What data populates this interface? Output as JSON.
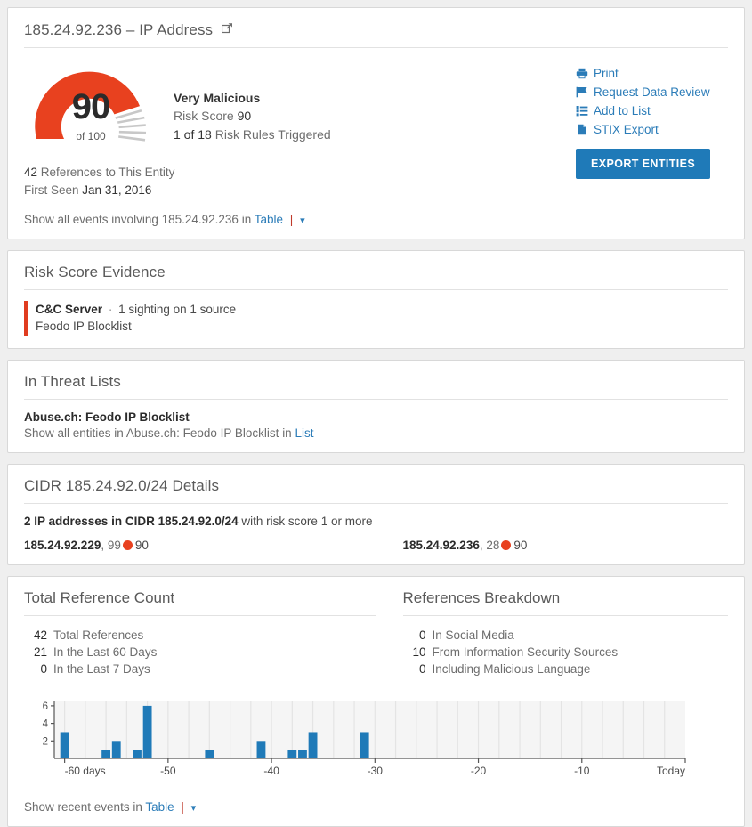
{
  "header": {
    "entity": "185.24.92.236",
    "dash": "–",
    "type": "IP Address",
    "ext_link_icon": "external-link-icon",
    "risk": {
      "score": "90",
      "of_label": "of 100",
      "level": "Very Malicious",
      "score_label_prefix": "Risk Score",
      "score_label_value": "90",
      "rules_count": "1 of 18",
      "rules_label": "Risk Rules Triggered",
      "gauge_color": "#e8411f",
      "gauge_track_color": "#d0d0d0",
      "gauge_percent": 90
    },
    "references_count": "42",
    "references_label": "References to This Entity",
    "first_seen_label": "First Seen",
    "first_seen_value": "Jan 31, 2016",
    "show_all_prefix": "Show all events involving",
    "show_all_entity": "185.24.92.236",
    "show_all_in": "in",
    "show_all_link": "Table",
    "actions": [
      {
        "label": "Print",
        "icon": "printer-icon"
      },
      {
        "label": "Request Data Review",
        "icon": "flag-icon"
      },
      {
        "label": "Add to List",
        "icon": "list-icon"
      },
      {
        "label": "STIX Export",
        "icon": "document-icon"
      }
    ],
    "export_button": "EXPORT ENTITIES",
    "export_button_color": "#1f7ab8"
  },
  "risk_evidence": {
    "title": "Risk Score Evidence",
    "accent_color": "#e03c20",
    "items": [
      {
        "name": "C&C Server",
        "bullet": "·",
        "detail": "1 sighting on 1 source",
        "source": "Feodo IP Blocklist"
      }
    ]
  },
  "threat_lists": {
    "title": "In Threat Lists",
    "name": "Abuse.ch: Feodo IP Blocklist",
    "show_prefix": "Show all entities in",
    "show_list_name": "Abuse.ch: Feodo IP Blocklist",
    "show_in": "in",
    "show_link": "List"
  },
  "cidr": {
    "title": "CIDR 185.24.92.0/24 Details",
    "summary_bold": "2 IP addresses in CIDR 185.24.92.0/24",
    "summary_rest": "with risk score 1 or more",
    "entries": [
      {
        "ip": "185.24.92.229",
        "comma": ",",
        "count": "99",
        "score": "90",
        "dot_color": "#e8411f"
      },
      {
        "ip": "185.24.92.236",
        "comma": ",",
        "count": "28",
        "score": "90",
        "dot_color": "#e8411f"
      }
    ]
  },
  "reference_count": {
    "title": "Total Reference Count",
    "stats": [
      {
        "num": "42",
        "label": "Total References"
      },
      {
        "num": "21",
        "label": "In the Last 60 Days"
      },
      {
        "num": "0",
        "label": "In the Last 7 Days"
      }
    ]
  },
  "references_breakdown": {
    "title": "References Breakdown",
    "stats": [
      {
        "num": "0",
        "label": "In Social Media"
      },
      {
        "num": "10",
        "label": "From Information Security Sources"
      },
      {
        "num": "0",
        "label": "Including Malicious Language"
      }
    ]
  },
  "footer": {
    "show_prefix": "Show recent events in",
    "show_link": "Table"
  },
  "chart_data": {
    "type": "bar",
    "title": "",
    "xlabel": "",
    "ylabel": "",
    "bar_color": "#1f7ab8",
    "plot_bg": "#f5f5f5",
    "grid_color": "#e4e4e4",
    "grid": true,
    "legend": false,
    "ylim": [
      0,
      6.6
    ],
    "yticks": [
      2,
      4,
      6
    ],
    "ytick_labels": [
      "2",
      "4",
      "6"
    ],
    "xlim": [
      -61,
      0
    ],
    "xticks": [
      -60,
      -50,
      -40,
      -30,
      -20,
      -10,
      0
    ],
    "xtick_labels": [
      "-60 days",
      "-50",
      "-40",
      "-30",
      "-20",
      "-10",
      "Today"
    ],
    "x": [
      -60,
      -56,
      -55,
      -53,
      -52,
      -46,
      -41,
      -38,
      -37,
      -36,
      -31
    ],
    "values": [
      3,
      1,
      2,
      1,
      6,
      1,
      2,
      1,
      1,
      3,
      3
    ]
  }
}
